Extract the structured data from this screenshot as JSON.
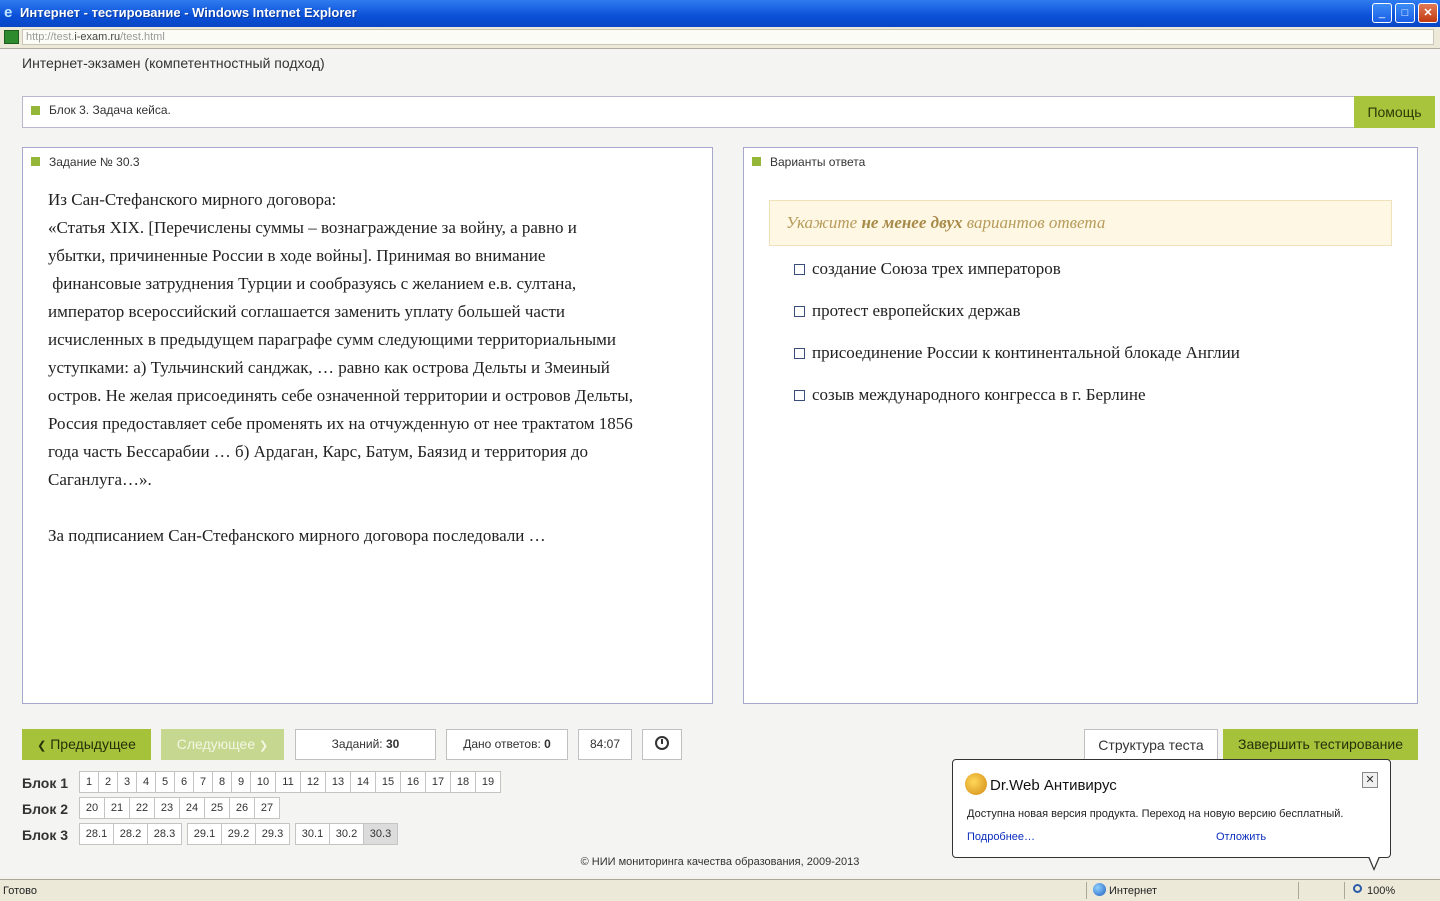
{
  "window": {
    "title": "Интернет - тестирование - Windows Internet Explorer",
    "min_glyph": "_",
    "max_glyph": "□",
    "close_glyph": "✕"
  },
  "address": {
    "prefix": "http://test.",
    "domain": "i-exam.ru",
    "suffix": "/test.html"
  },
  "page": {
    "heading": "Интернет-экзамен (компетентностный подход)",
    "block_title": "Блок 3. Задача кейса.",
    "help_label": "Помощь"
  },
  "task": {
    "label": "Задание № 30.3",
    "lines": [
      "Из Сан-Стефанского мирного договора:",
      "«Статья XIX. [Перечислены суммы – вознаграждение за войну, а равно и",
      "убытки, причиненные России в ходе войны]. Принимая во внимание",
      " финансовые затруднения Турции и сообразуясь с желанием е.в. султана,",
      "император всероссийский соглашается заменить уплату большей части",
      "исчисленных в предыдущем параграфе сумм следующими территориальными",
      "уступками: а) Тульчинский санджак, … равно как острова Дельты и Змеиный",
      "остров. Не желая присоединять себе означенной территории и островов Дельты,",
      "Россия предоставляет себе променять их на отчужденную от нее трактатом 1856",
      "года часть Бессарабии … б) Ардаган, Карс, Батум, Баязид и территория до",
      "Саганлуга…»."
    ],
    "question": "За подписанием Сан-Стефанского мирного договора последовали …"
  },
  "answers": {
    "label": "Варианты ответа",
    "hint_before": "Укажите ",
    "hint_bold": "не менее двух",
    "hint_after": " вариантов ответа",
    "options": [
      "создание Союза трех императоров",
      "протест европейских держав",
      "присоединение России к континентальной блокаде Англии",
      "созыв международного конгресса в г. Берлине"
    ]
  },
  "controls": {
    "prev_label": "Предыдущее",
    "prev_glyph": "❮",
    "next_label": "Следующее",
    "next_glyph": "❯",
    "tasks_label": "Заданий: ",
    "tasks_value": "30",
    "answers_label": "Дано ответов: ",
    "answers_value": "0",
    "timer": "84:07",
    "structure_label": "Структура теста",
    "finish_label": "Завершить тестирование"
  },
  "blocks": [
    {
      "label": "Блок 1",
      "items": [
        "1",
        "2",
        "3",
        "4",
        "5",
        "6",
        "7",
        "8",
        "9",
        "10",
        "11",
        "12",
        "13",
        "14",
        "15",
        "16",
        "17",
        "18",
        "19"
      ]
    },
    {
      "label": "Блок 2",
      "items": [
        "20",
        "21",
        "22",
        "23",
        "24",
        "25",
        "26",
        "27"
      ]
    },
    {
      "label": "Блок 3",
      "items": [
        "28.1",
        "28.2",
        "28.3",
        "29.1",
        "29.2",
        "29.3",
        "30.1",
        "30.2",
        "30.3"
      ],
      "active": "30.3"
    }
  ],
  "footer": {
    "copyright": "© НИИ мониторинга качества образования, 2009-2013"
  },
  "drweb": {
    "brand": "Dr.Web Антивирус",
    "close_glyph": "✕",
    "message": "Доступна новая версия продукта. Переход на новую версию бесплатный.",
    "more_link": "Подробнее…",
    "later_link": "Отложить"
  },
  "statusbar": {
    "ready": "Готово",
    "zone": "Интернет",
    "zoom": "100%"
  }
}
